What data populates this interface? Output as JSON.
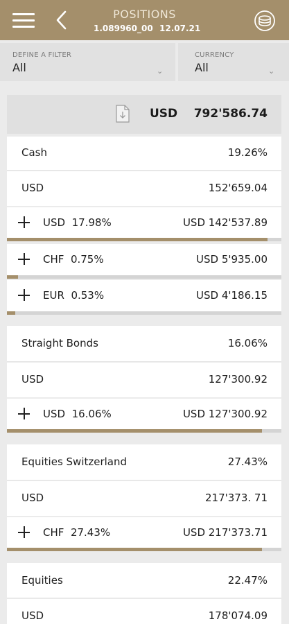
{
  "header": {
    "title": "POSITIONS",
    "account": "1.089960_00",
    "date": "12.07.21"
  },
  "filters": {
    "filter_label": "DEFINE A FILTER",
    "filter_value": "All",
    "currency_label": "CURRENCY",
    "currency_value": "All"
  },
  "total": {
    "currency": "USD",
    "value": "792'586.74"
  },
  "groups": [
    {
      "name": "Cash",
      "pct": "19.26%",
      "currency": "USD",
      "amount": "152'659.04",
      "items": [
        {
          "currency": "USD",
          "pct": "17.98%",
          "value": "USD 142'537.89",
          "share": 0.95
        },
        {
          "currency": "CHF",
          "pct": "0.75%",
          "value": "USD 5'935.00",
          "share": 0.04
        },
        {
          "currency": "EUR",
          "pct": "0.53%",
          "value": "USD 4'186.15",
          "share": 0.03
        }
      ]
    },
    {
      "name": "Straight Bonds",
      "pct": "16.06%",
      "currency": "USD",
      "amount": "127'300.92",
      "items": [
        {
          "currency": "USD",
          "pct": "16.06%",
          "value": "USD 127'300.92",
          "share": 0.93
        }
      ]
    },
    {
      "name": "Equities Switzerland",
      "pct": "27.43%",
      "currency": "USD",
      "amount": "217'373. 71",
      "items": [
        {
          "currency": "CHF",
          "pct": "27.43%",
          "value": "USD 217'373.71",
          "share": 0.93
        }
      ]
    },
    {
      "name": "Equities",
      "pct": "22.47%",
      "currency": "USD",
      "amount": "178'074.09",
      "items": []
    }
  ],
  "colors": {
    "brand": "#a48f6b",
    "background": "#ebebeb",
    "bar_track": "#d4d4d4"
  },
  "icons": [
    "menu-icon",
    "back-chevron-icon",
    "coin-stack-icon",
    "download-document-icon",
    "plus-icon",
    "chevron-down-icon"
  ]
}
